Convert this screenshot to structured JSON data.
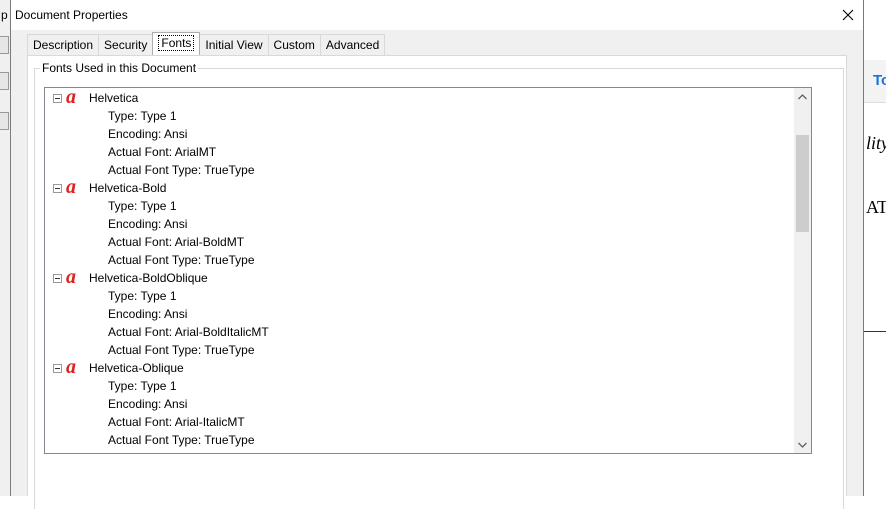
{
  "background": {
    "title_fragment": "p",
    "right_tab_fragment": "To",
    "right_text_1": "lity",
    "right_text_2": "AT"
  },
  "dialog": {
    "title": "Document Properties",
    "tabs": [
      {
        "label": "Description",
        "active": false
      },
      {
        "label": "Security",
        "active": false
      },
      {
        "label": "Fonts",
        "active": true
      },
      {
        "label": "Initial View",
        "active": false
      },
      {
        "label": "Custom",
        "active": false
      },
      {
        "label": "Advanced",
        "active": false
      }
    ],
    "group_label": "Fonts Used in this Document",
    "fonts": [
      {
        "name": "Helvetica",
        "type": "Type: Type 1",
        "encoding": "Encoding: Ansi",
        "actual_font": "Actual Font: ArialMT",
        "actual_font_type": "Actual Font Type: TrueType"
      },
      {
        "name": "Helvetica-Bold",
        "type": "Type: Type 1",
        "encoding": "Encoding: Ansi",
        "actual_font": "Actual Font: Arial-BoldMT",
        "actual_font_type": "Actual Font Type: TrueType"
      },
      {
        "name": "Helvetica-BoldOblique",
        "type": "Type: Type 1",
        "encoding": "Encoding: Ansi",
        "actual_font": "Actual Font: Arial-BoldItalicMT",
        "actual_font_type": "Actual Font Type: TrueType"
      },
      {
        "name": "Helvetica-Oblique",
        "type": "Type: Type 1",
        "encoding": "Encoding: Ansi",
        "actual_font": "Actual Font: Arial-ItalicMT",
        "actual_font_type": "Actual Font Type: TrueType"
      }
    ],
    "font_icon_glyph": "a",
    "font_icon": "font-type-icon",
    "font_icon_color": "#dd2222"
  }
}
